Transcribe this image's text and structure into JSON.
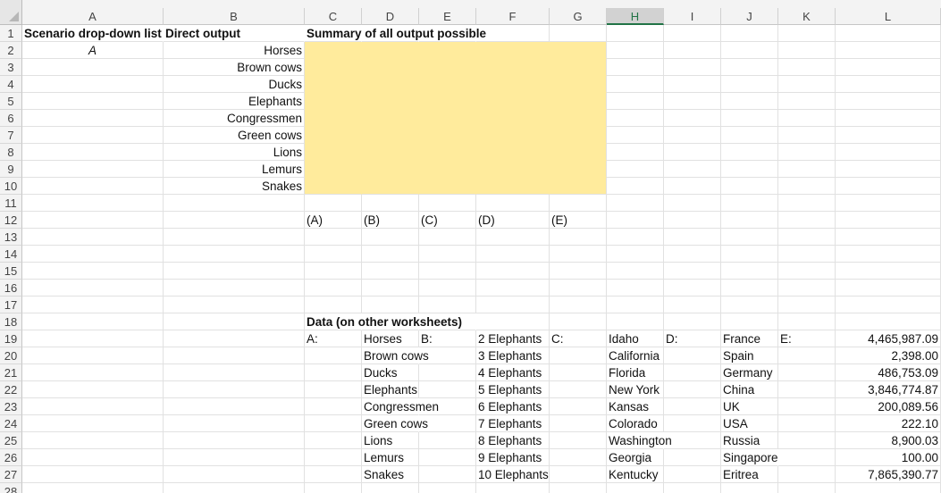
{
  "spreadsheet": {
    "columns": [
      "A",
      "B",
      "C",
      "D",
      "E",
      "F",
      "G",
      "H",
      "I",
      "J",
      "K",
      "L"
    ],
    "selected_column": "H",
    "rows": [
      "1",
      "2",
      "3",
      "4",
      "5",
      "6",
      "7",
      "8",
      "9",
      "10",
      "11",
      "12",
      "13",
      "14",
      "15",
      "16",
      "17",
      "18",
      "19",
      "20",
      "21",
      "22",
      "23",
      "24",
      "25",
      "26",
      "27",
      "28"
    ],
    "highlight_color": "#ffeb9c",
    "cells": {
      "A1": "Scenario drop-down list",
      "B1": "Direct output",
      "C1": "Summary of all output possible",
      "A2": "A",
      "B2": "Horses",
      "B3": "Brown cows",
      "B4": "Ducks",
      "B5": "Elephants",
      "B6": "Congressmen",
      "B7": "Green cows",
      "B8": "Lions",
      "B9": "Lemurs",
      "B10": "Snakes",
      "C12": "(A)",
      "D12": "(B)",
      "E12": "(C)",
      "F12": "(D)",
      "G12": "(E)",
      "C18": "Data (on other worksheets)",
      "C19": "A:",
      "D19": "Horses",
      "E19": "B:",
      "F19": "2 Elephants",
      "G19": "C:",
      "H19": "Idaho",
      "I19": "D:",
      "J19": "France",
      "K19": "E:",
      "L19": "4,465,987.09",
      "D20": "Brown cows",
      "F20": "3 Elephants",
      "H20": "California",
      "J20": "Spain",
      "L20": "2,398.00",
      "D21": "Ducks",
      "F21": "4 Elephants",
      "H21": "Florida",
      "J21": "Germany",
      "L21": "486,753.09",
      "D22": "Elephants",
      "F22": "5 Elephants",
      "H22": "New York",
      "J22": "China",
      "L22": "3,846,774.87",
      "D23": "Congressmen",
      "F23": "6 Elephants",
      "H23": "Kansas",
      "J23": "UK",
      "L23": "200,089.56",
      "D24": "Green cows",
      "F24": "7 Elephants",
      "H24": "Colorado",
      "J24": "USA",
      "L24": "222.10",
      "D25": "Lions",
      "F25": "8 Elephants",
      "H25": "Washington",
      "J25": "Russia",
      "L25": "8,900.03",
      "D26": "Lemurs",
      "F26": "9 Elephants",
      "H26": "Georgia",
      "J26": "Singapore",
      "L26": "100.00",
      "D27": "Snakes",
      "F27": "10 Elephants",
      "H27": "Kentucky",
      "J27": "Eritrea",
      "L27": "7,865,390.77"
    }
  }
}
